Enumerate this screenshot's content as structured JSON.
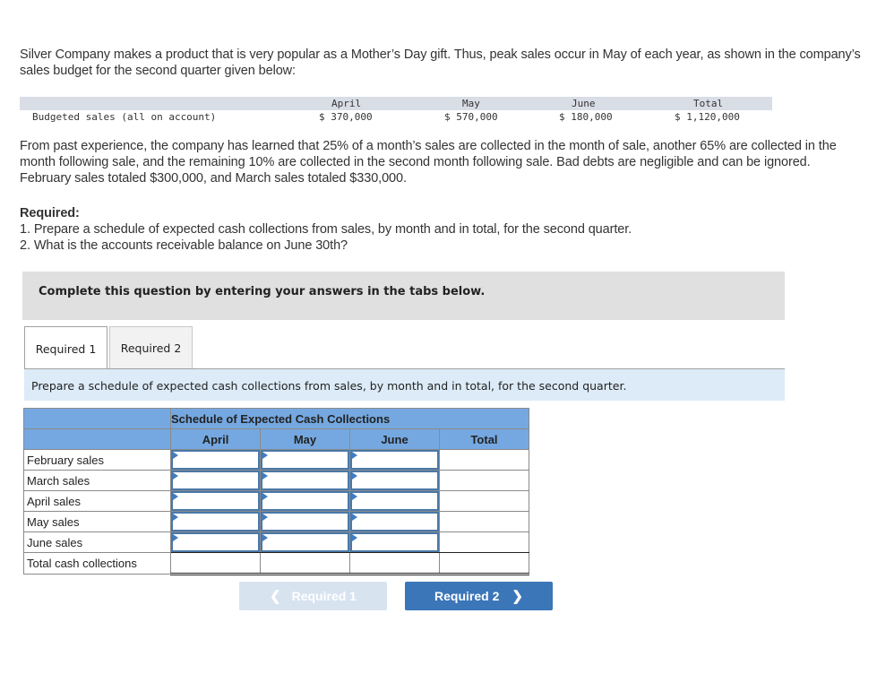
{
  "intro": "Silver Company makes a product that is very popular as a Mother’s Day gift. Thus, peak sales occur in May of each year, as shown in the company’s sales budget for the second quarter given below:",
  "budget": {
    "headers": [
      "April",
      "May",
      "June",
      "Total"
    ],
    "row_label": "Budgeted sales (all on account)",
    "values": [
      "$ 370,000",
      "$ 570,000",
      "$ 180,000",
      "$ 1,120,000"
    ]
  },
  "paragraph": "From past experience, the company has learned that 25% of a month’s sales are collected in the month of sale, another 65% are collected in the month following sale, and the remaining 10% are collected in the second month following sale. Bad debts are negligible and can be ignored. February sales totaled $300,000, and March sales totaled $330,000.",
  "required": {
    "title": "Required:",
    "items": [
      "1. Prepare a schedule of expected cash collections from sales, by month and in total, for the second quarter.",
      "2. What is the accounts receivable balance on June 30th?"
    ]
  },
  "banner": "Complete this question by entering your answers in the tabs below.",
  "tabs": [
    {
      "label": "Required 1",
      "active": true
    },
    {
      "label": "Required 2",
      "active": false
    }
  ],
  "instruction": "Prepare a schedule of expected cash collections from sales, by month and in total, for the second quarter.",
  "schedule": {
    "title": "Schedule of Expected Cash Collections",
    "columns": [
      "April",
      "May",
      "June",
      "Total"
    ],
    "rows": [
      {
        "label": "February sales",
        "values": [
          "",
          "",
          "",
          ""
        ]
      },
      {
        "label": "March sales",
        "values": [
          "",
          "",
          "",
          ""
        ]
      },
      {
        "label": "April sales",
        "values": [
          "",
          "",
          "",
          ""
        ]
      },
      {
        "label": "May sales",
        "values": [
          "",
          "",
          "",
          ""
        ]
      },
      {
        "label": "June sales",
        "values": [
          "",
          "",
          "",
          ""
        ]
      },
      {
        "label": "Total cash collections",
        "values": [
          "",
          "",
          "",
          ""
        ]
      }
    ]
  },
  "nav": {
    "prev_label": "Required 1",
    "next_label": "Required 2",
    "prev_icon": "chevron-left-icon",
    "next_icon": "chevron-right-icon"
  }
}
